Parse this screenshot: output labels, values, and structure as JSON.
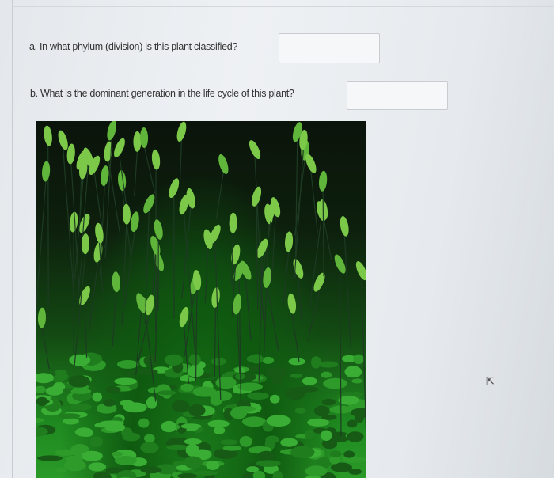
{
  "questions": [
    {
      "label": "a. In what phylum (division) is this plant classified?",
      "value": ""
    },
    {
      "label": "b. What is the dominant generation in the life cycle of this plant?",
      "value": ""
    }
  ],
  "image": {
    "subject": "moss-photo"
  },
  "colors": {
    "moss": "#2e9a2a",
    "capsule": "#8fd45a"
  }
}
